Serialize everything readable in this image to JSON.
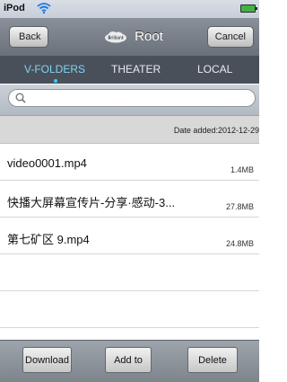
{
  "status_bar": {
    "carrier": "iPod",
    "wifi_icon": "wifi-icon",
    "battery_icon": "battery-icon"
  },
  "nav": {
    "back_label": "Back",
    "title": "Root",
    "cancel_label": "Cancel",
    "title_icon": "cloud-icon",
    "title_icon_text": "Brilliant"
  },
  "tabs": [
    {
      "label": "V-FOLDERS",
      "active": true
    },
    {
      "label": "THEATER",
      "active": false
    },
    {
      "label": "LOCAL",
      "active": false
    }
  ],
  "search": {
    "value": "",
    "placeholder": ""
  },
  "sort_info": "Date added:2012-12-29",
  "files": [
    {
      "name": "video0001.mp4",
      "size": "1.4MB"
    },
    {
      "name": "快播大屏幕宣传片-分享·感动-3...",
      "size": "27.8MB"
    },
    {
      "name": "第七矿区 9.mp4",
      "size": "24.8MB"
    }
  ],
  "toolbar": {
    "download_label": "Download",
    "add_to_label": "Add to",
    "delete_label": "Delete"
  },
  "colors": {
    "accent": "#3fc7f7",
    "nav_bg": "#6a717b",
    "tab_bg": "#4a5059"
  }
}
